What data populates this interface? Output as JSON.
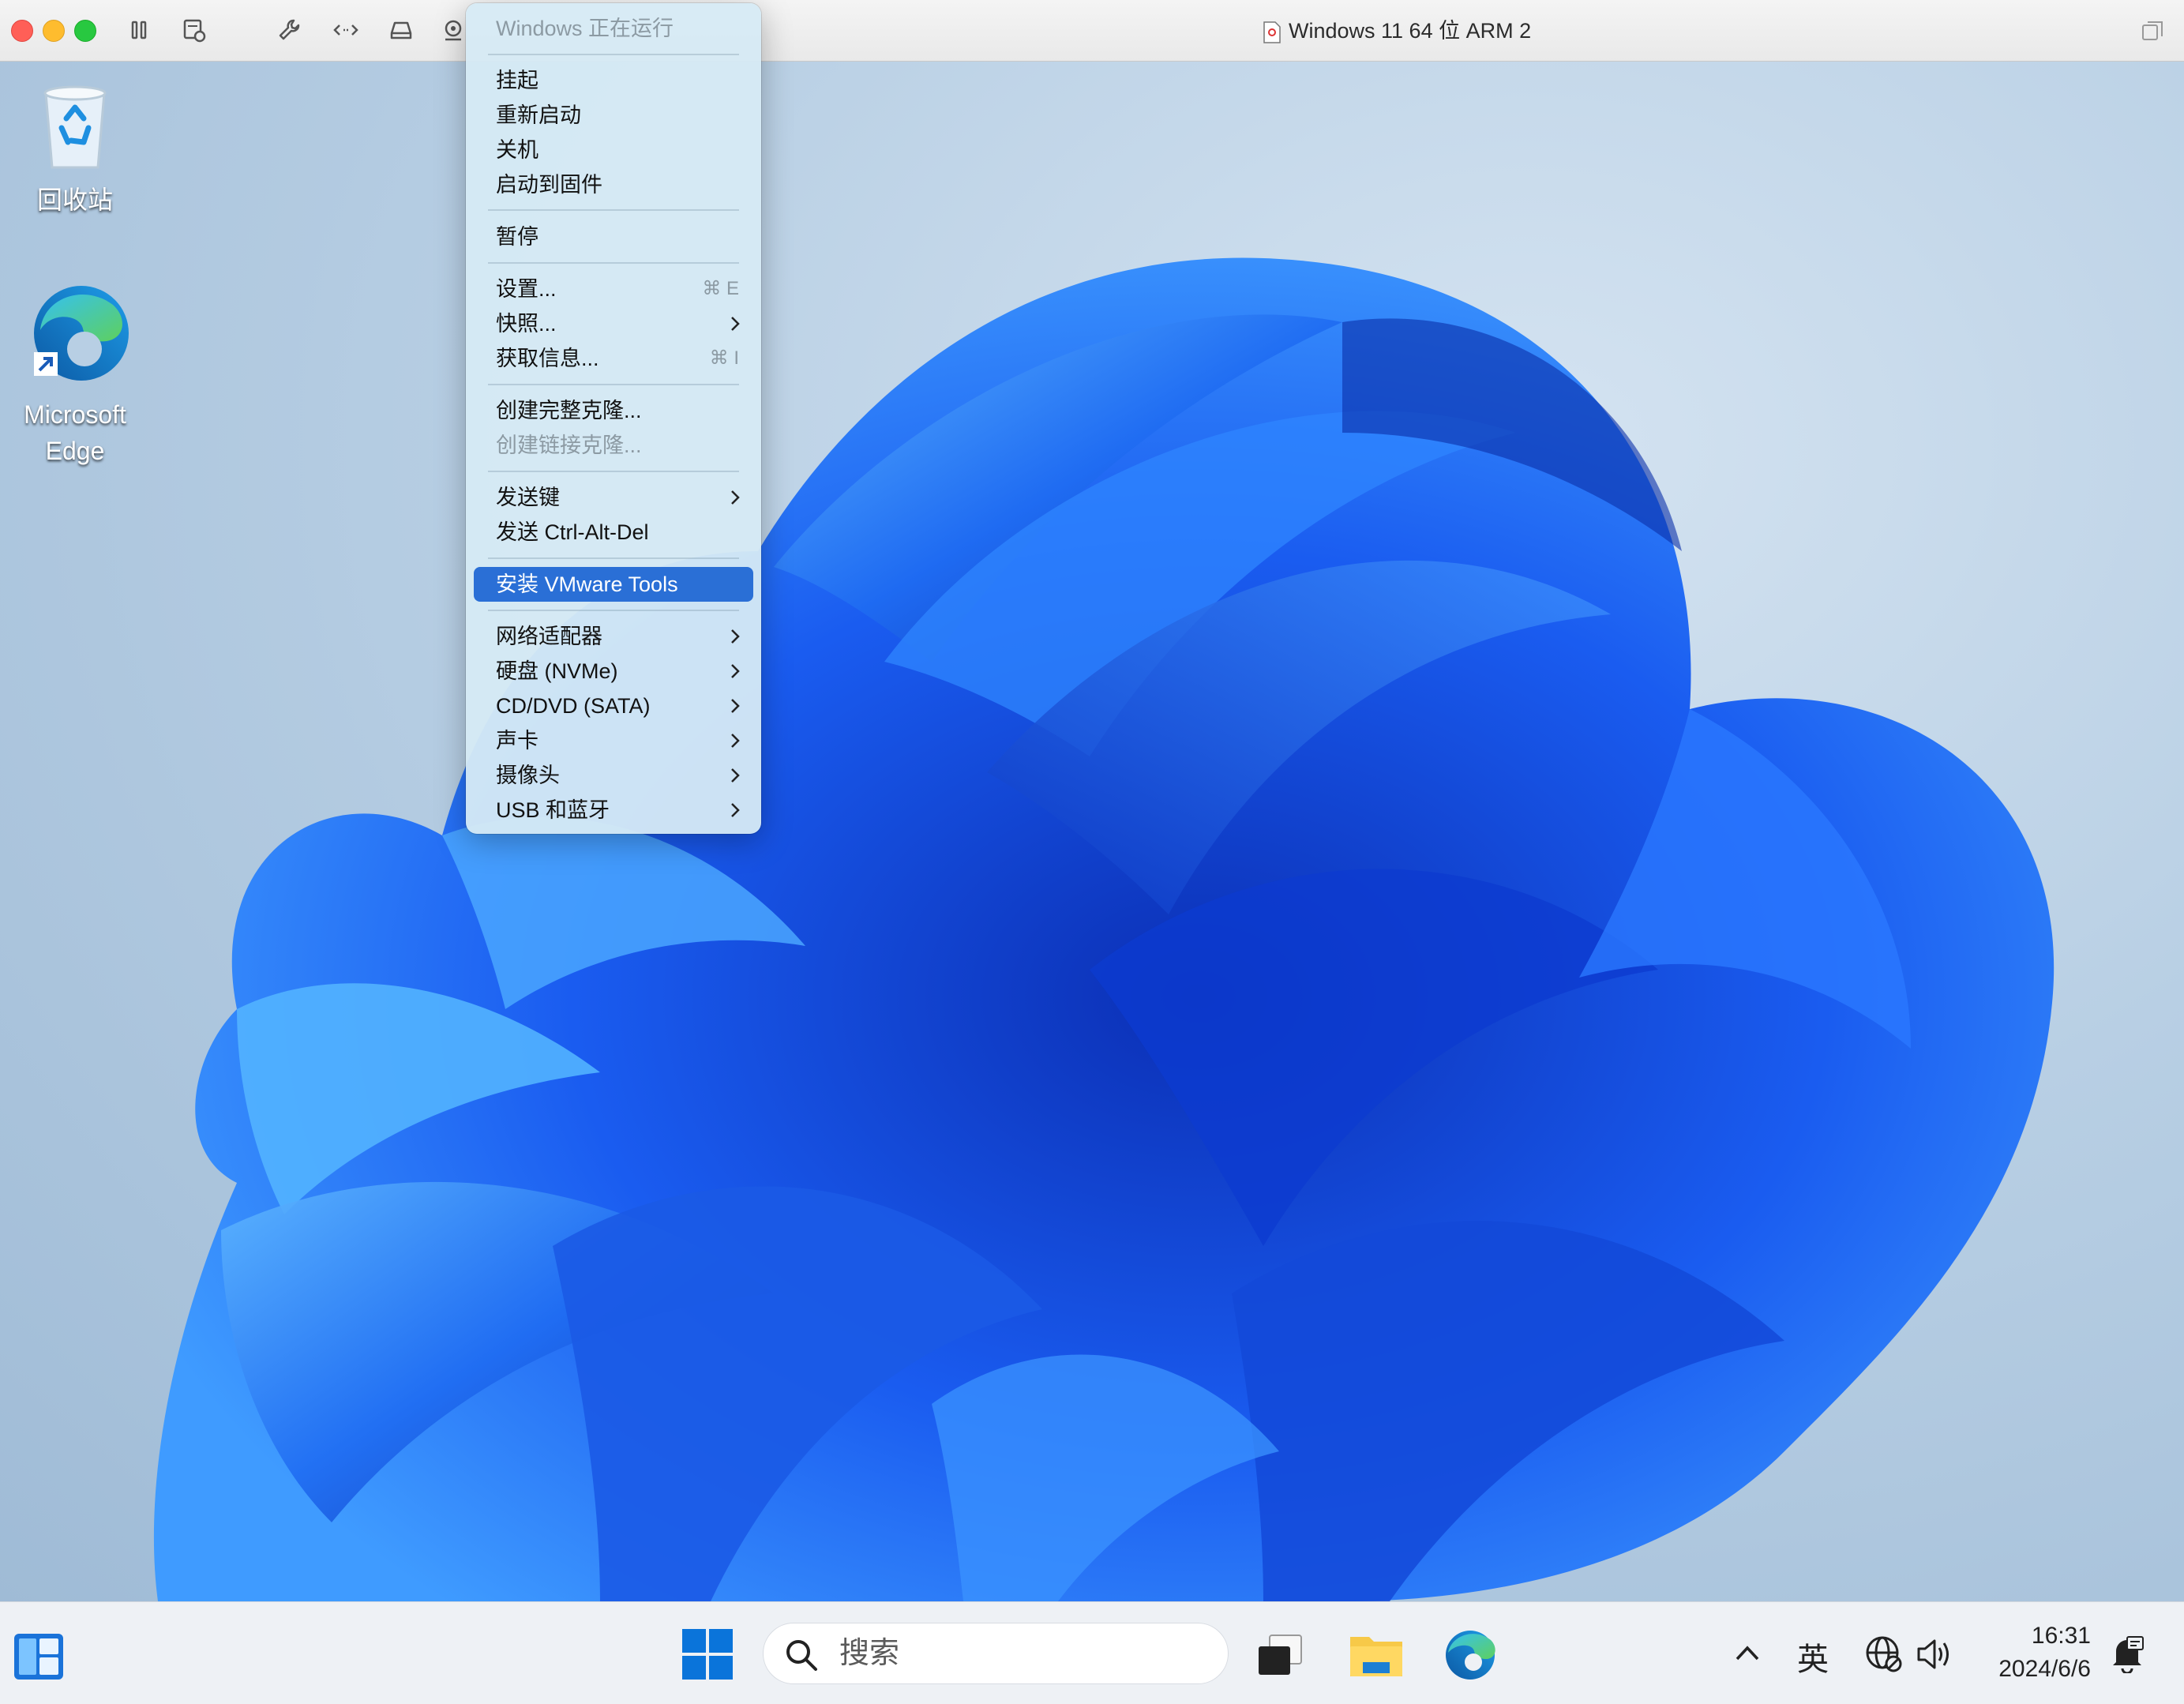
{
  "window": {
    "title": "Windows 11 64 位 ARM 2"
  },
  "toolbar": {
    "icons": [
      "pause-icon",
      "snapshot-icon",
      "wrench-icon",
      "code-arrows-icon",
      "drive-icon",
      "camera-icon"
    ]
  },
  "desktop": {
    "icons": [
      {
        "label": "回收站"
      },
      {
        "label_line1": "Microsoft",
        "label_line2": "Edge"
      }
    ]
  },
  "menu": {
    "header": "Windows 正在运行",
    "items": {
      "suspend": "挂起",
      "restart": "重新启动",
      "shutdown": "关机",
      "boot_firmware": "启动到固件",
      "pause": "暂停",
      "settings": "设置...",
      "settings_shortcut": "⌘ E",
      "snapshot": "快照...",
      "get_info": "获取信息...",
      "get_info_shortcut": "⌘ I",
      "full_clone": "创建完整克隆...",
      "linked_clone": "创建链接克隆...",
      "send_key": "发送键",
      "send_cad": "发送 Ctrl-Alt-Del",
      "install_tools": "安装 VMware Tools",
      "network": "网络适配器",
      "disk": "硬盘 (NVMe)",
      "cddvd": "CD/DVD (SATA)",
      "sound": "声卡",
      "camera": "摄像头",
      "usb": "USB 和蓝牙"
    }
  },
  "taskbar": {
    "search_placeholder": "搜索",
    "ime": "英",
    "time": "16:31",
    "date": "2024/6/6"
  },
  "colors": {
    "menu_highlight": "#2a6fd6",
    "windows_blue": "#0a74da",
    "folder_yellow": "#f7c948"
  }
}
